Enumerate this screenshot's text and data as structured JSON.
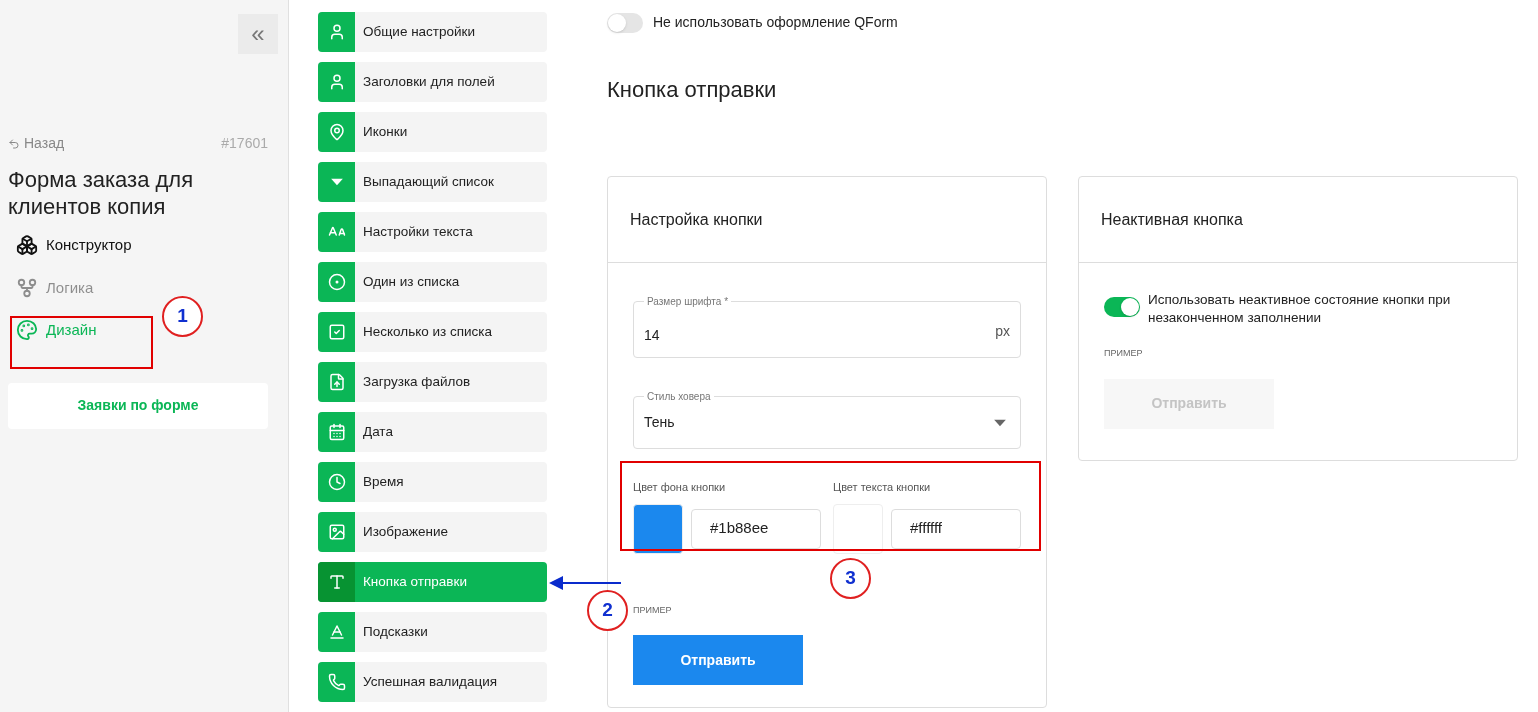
{
  "sidebar": {
    "collapse_icon": "«",
    "back_link": "Назад",
    "form_id": "#17601",
    "form_title": "Форма заказа для клиентов копия",
    "nav": [
      {
        "label": "Конструктор",
        "selected": false,
        "disabled": false
      },
      {
        "label": "Логика",
        "selected": false,
        "disabled": true
      },
      {
        "label": "Дизайн",
        "selected": true,
        "disabled": false
      }
    ],
    "submissions_button": "Заявки по форме"
  },
  "settings_menu": [
    {
      "label": "Общие настройки",
      "selected": false
    },
    {
      "label": "Заголовки для полей",
      "selected": false
    },
    {
      "label": "Иконки",
      "selected": false
    },
    {
      "label": "Выпадающий список",
      "selected": false
    },
    {
      "label": "Настройки текста",
      "selected": false
    },
    {
      "label": "Один из списка",
      "selected": false
    },
    {
      "label": "Несколько из списка",
      "selected": false
    },
    {
      "label": "Загрузка файлов",
      "selected": false
    },
    {
      "label": "Дата",
      "selected": false
    },
    {
      "label": "Время",
      "selected": false
    },
    {
      "label": "Изображение",
      "selected": false
    },
    {
      "label": "Кнопка отправки",
      "selected": true
    },
    {
      "label": "Подсказки",
      "selected": false
    },
    {
      "label": "Успешная валидация",
      "selected": false
    }
  ],
  "main": {
    "disable_styling": {
      "label": "Не использовать оформление QForm",
      "on": false
    },
    "title": "Кнопка отправки",
    "button_settings": {
      "title": "Настройка кнопки",
      "font_size": {
        "label": "Размер шрифта *",
        "value": "14",
        "unit": "px"
      },
      "hover_style": {
        "label": "Стиль ховера",
        "value": "Тень"
      },
      "background_color": {
        "label": "Цвет фона кнопки",
        "value": "#1b88ee",
        "color": "#1b88ee"
      },
      "text_color": {
        "label": "Цвет текста кнопки",
        "value": "#ffffff",
        "color": "#ffffff"
      },
      "example_label": "ПРИМЕР",
      "example_button": "Отправить"
    },
    "inactive_button": {
      "title": "Неактивная кнопка",
      "toggle": {
        "label": "Использовать неактивное состояние кнопки при незаконченном заполнении",
        "on": true
      },
      "example_label": "ПРИМЕР",
      "example_button": "Отправить"
    }
  },
  "annotations": [
    {
      "label": "1"
    },
    {
      "label": "2"
    },
    {
      "label": "3"
    }
  ]
}
